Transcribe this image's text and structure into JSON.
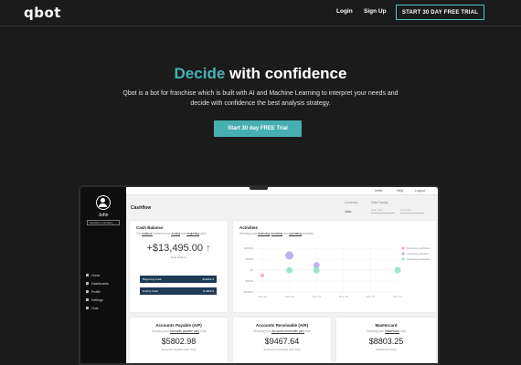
{
  "nav": {
    "logo": "qbot",
    "login": "Login",
    "signup": "Sign Up",
    "cta": "START 30 DAY FREE TRIAL"
  },
  "hero": {
    "title_accent": "Decide",
    "title_rest": " with confidence",
    "subtitle": "Qbot is a bot for franchise which is built with AI and Machine Learning to interpret your needs and decide with confidence the best analysis strategy.",
    "button": "Start 30 day FREE Trial"
  },
  "colors": {
    "accent": "#45b3b6",
    "background": "#1b1b1b",
    "positive": "#2e9a5a",
    "dark_bar": "#1e3a55"
  },
  "app": {
    "user_name": "John",
    "company_select": "Sandbox Company_...",
    "menu": [
      {
        "label": "Home",
        "icon": "home-icon"
      },
      {
        "label": "Dashboards",
        "icon": "dashboard-icon"
      },
      {
        "label": "Profile",
        "icon": "profile-icon"
      },
      {
        "label": "Settings",
        "icon": "settings-icon"
      },
      {
        "label": "Chat",
        "icon": "chat-icon"
      }
    ],
    "topbar": {
      "invite": "Invite",
      "help": "Help",
      "logout": "Logout"
    },
    "page_title": "Cashflow",
    "filters": {
      "currency_label": "Currency",
      "currency_value": "Jolo",
      "date_label": "Date Range",
      "date_start": "Start date",
      "date_end": "End date"
    },
    "cash_balance": {
      "title": "Cash Balance",
      "sub_pre": "The ",
      "sub_b1": "balance",
      "sub_mid": " between your ",
      "sub_b2": "ending",
      "sub_and": " and ",
      "sub_b3": "beginning",
      "sub_post": " cash",
      "value": "+$13,495.00",
      "arrow": "↑",
      "caption": "Total balance",
      "beginning_label": "Beginning Cash",
      "beginning_value": "$18462.3",
      "ending_label": "Ending Cash",
      "ending_value": "$-4966.3"
    },
    "activities": {
      "title": "Activities",
      "sub_pre": "Showing your ",
      "sub_b1": "financing",
      "sub_b2": "investing",
      "sub_and": " and ",
      "sub_b3": "operating",
      "sub_post": " activities",
      "legend": [
        "Financing activities",
        "Investing activities",
        "Operating activities"
      ]
    },
    "metrics": [
      {
        "title": "Accounts Payable (A/P)",
        "sub_pre": "Showing your ",
        "sub_b": "Accounts payable (a/p)",
        "sub_post": " total",
        "value": "$5802.98",
        "caption": "Accounts payable (a/p) Total"
      },
      {
        "title": "Accounts Receivable (A/R)",
        "sub_pre": "Showing your ",
        "sub_b": "Accounts receivable (a/r)",
        "sub_post": " total",
        "value": "$9467.64",
        "caption": "Accounts receivable (a/r) Total"
      },
      {
        "title": "Mastercard",
        "sub_pre": "Showing your ",
        "sub_b": "Mastercard",
        "sub_post": " total",
        "value": "$8803.25",
        "caption": "Mastercard Total"
      }
    ]
  },
  "chart_data": {
    "type": "scatter",
    "title": "Activities",
    "x": [
      "Nov 12",
      "Nov 13",
      "Nov 14",
      "Nov 15",
      "Nov 16",
      "Nov 17"
    ],
    "ylabel": "",
    "y_ticks": [
      "$10000",
      "$5000",
      "$0",
      "-$5000",
      "-$10000"
    ],
    "ylim": [
      -10000,
      10000
    ],
    "series": [
      {
        "name": "Financing activities",
        "color": "#f4a7b5",
        "points": [
          {
            "x": "Nov 12",
            "y": -2400
          }
        ]
      },
      {
        "name": "Investing activities",
        "color": "#b9a8e8",
        "points": [
          {
            "x": "Nov 13",
            "y": 6700
          },
          {
            "x": "Nov 14",
            "y": 2200
          }
        ]
      },
      {
        "name": "Operating activities",
        "color": "#8fe3c4",
        "points": [
          {
            "x": "Nov 13",
            "y": 0
          },
          {
            "x": "Nov 14",
            "y": 0
          },
          {
            "x": "Nov 17",
            "y": 0
          }
        ]
      }
    ]
  }
}
